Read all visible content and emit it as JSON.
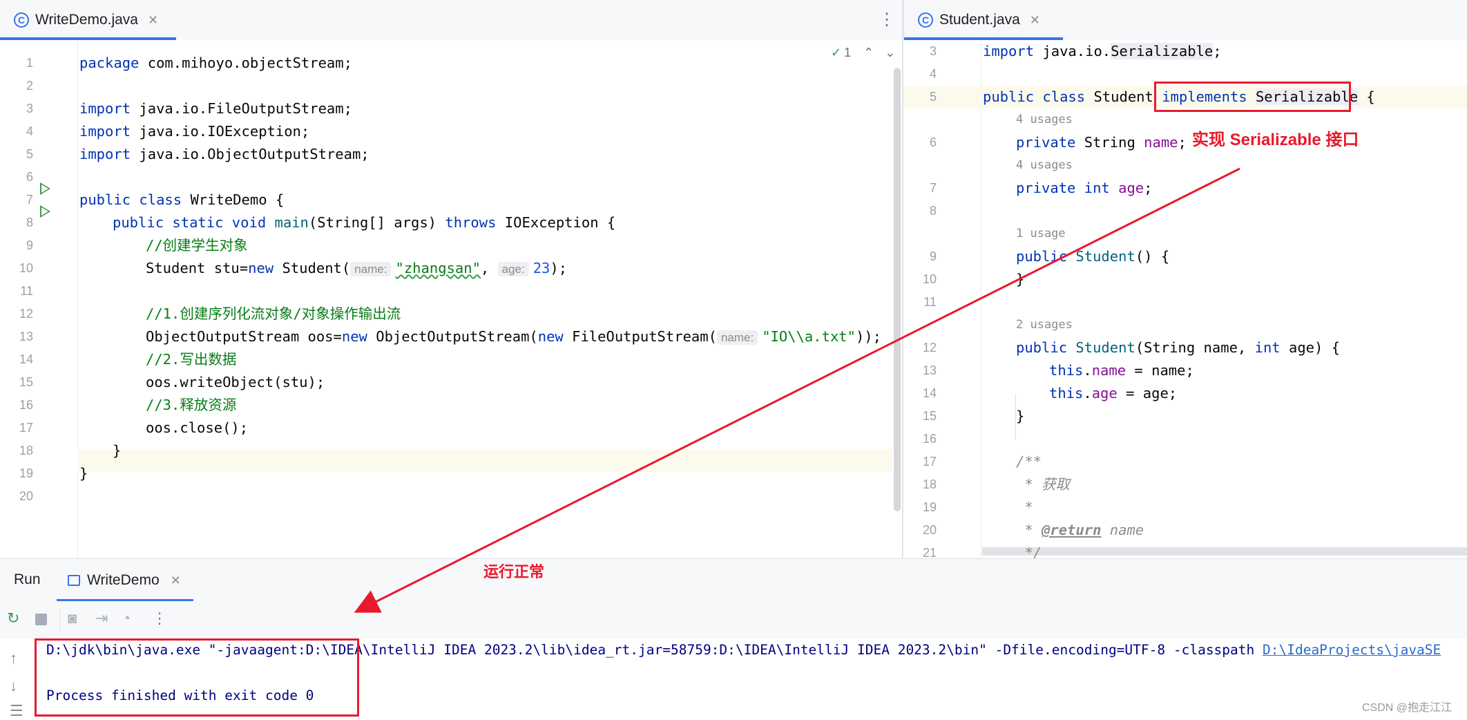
{
  "left_tab": {
    "label": "WriteDemo.java"
  },
  "right_tab": {
    "label": "Student.java"
  },
  "inspection": {
    "count": "1"
  },
  "left_code": {
    "line_numbers": [
      "1",
      "2",
      "3",
      "4",
      "5",
      "6",
      "7",
      "8",
      "9",
      "10",
      "11",
      "12",
      "13",
      "14",
      "15",
      "16",
      "17",
      "18",
      "19",
      "20"
    ],
    "l1_kw": "package",
    "l1_rest": " com.mihoyo.objectStream;",
    "l3_kw": "import",
    "l3_rest": " java.io.FileOutputStream;",
    "l4_kw": "import",
    "l4_rest": " java.io.IOException;",
    "l5_kw": "import",
    "l5_rest": " java.io.ObjectOutputStream;",
    "l7_kw": "public class",
    "l7_rest": " WriteDemo {",
    "l8_kw1": "public static void",
    "l8_fn": "main",
    "l8_mid": "(String[] args) ",
    "l8_kw2": "throws",
    "l8_end": " IOException {",
    "l9_cm": "//创建学生对象",
    "l10_a": "Student stu=",
    "l10_kw": "new",
    "l10_b": " Student(",
    "l10_h1": "name:",
    "l10_s": "\"zhangsan\"",
    "l10_c": ", ",
    "l10_h2": "age:",
    "l10_n": "23",
    "l10_d": ");",
    "l12_cm": "//1.创建序列化流对象/对象操作输出流",
    "l13_a": "ObjectOutputStream oos=",
    "l13_kw1": "new",
    "l13_b": " ObjectOutputStream(",
    "l13_kw2": "new",
    "l13_c": " FileOutputStream(",
    "l13_h": "name:",
    "l13_s": "\"IO\\\\a.txt\"",
    "l13_d": "));",
    "l14_cm": "//2.写出数据",
    "l15": "oos.writeObject(stu);",
    "l16_cm": "//3.释放资源",
    "l17": "oos.close();",
    "l18": "}",
    "l19": "}"
  },
  "right_code": {
    "line_numbers": [
      "3",
      "4",
      "5",
      "6",
      "7",
      "8",
      "9",
      "10",
      "11",
      "12",
      "13",
      "14",
      "15",
      "16",
      "17",
      "18",
      "19",
      "20",
      "21"
    ],
    "r3_kw": "import",
    "r3_a": " java.io.",
    "r3_ser": "Serializable",
    "r3_b": ";",
    "r5_kw": "public class",
    "r5_a": " Student ",
    "r5_kw2": "implements",
    "r5_sp": " ",
    "r5_ser": "Serializable",
    "r5_b": " {",
    "u6": "4 usages",
    "r6_kw": "private",
    "r6_a": " String ",
    "r6_f": "name",
    "r6_b": ";",
    "u7": "4 usages",
    "r7_kw": "private int",
    "r7_sp": " ",
    "r7_f": "age",
    "r7_b": ";",
    "u9": "1 usage",
    "r9_kw": "public",
    "r9_sp": " ",
    "r9_fn": "Student",
    "r9_b": "() {",
    "r10": "}",
    "u12": "2 usages",
    "r12_kw": "public",
    "r12_sp": " ",
    "r12_fn": "Student",
    "r12_a": "(String name, ",
    "r12_kw2": "int",
    "r12_b": " age) {",
    "r13_kw": "this",
    "r13_dot": ".",
    "r13_f": "name",
    "r13_b": " = name;",
    "r14_kw": "this",
    "r14_dot": ".",
    "r14_f": "age",
    "r14_b": " = age;",
    "r15": "}",
    "r17": "/**",
    "r18": " * 获取",
    "r19": " *",
    "r20_a": " * ",
    "r20_tag": "@return",
    "r20_b": " name",
    "r21": " */"
  },
  "run_panel": {
    "title": "Run",
    "tab_label": "WriteDemo",
    "console_line1": "D:\\jdk\\bin\\java.exe \"-javaagent:D:\\IDEA\\IntelliJ IDEA 2023.2\\lib\\idea_rt.jar=58759:D:\\IDEA\\IntelliJ IDEA 2023.2\\bin\" -Dfile.encoding=UTF-8 -classpath ",
    "console_link": "D:\\IdeaProjects\\javaSE",
    "console_line2": "Process finished with exit code 0"
  },
  "annotations": {
    "implement_note": "实现 Serializable 接口",
    "run_note": "运行正常",
    "color": "#e8192c"
  },
  "watermark": "CSDN @抱走江江"
}
